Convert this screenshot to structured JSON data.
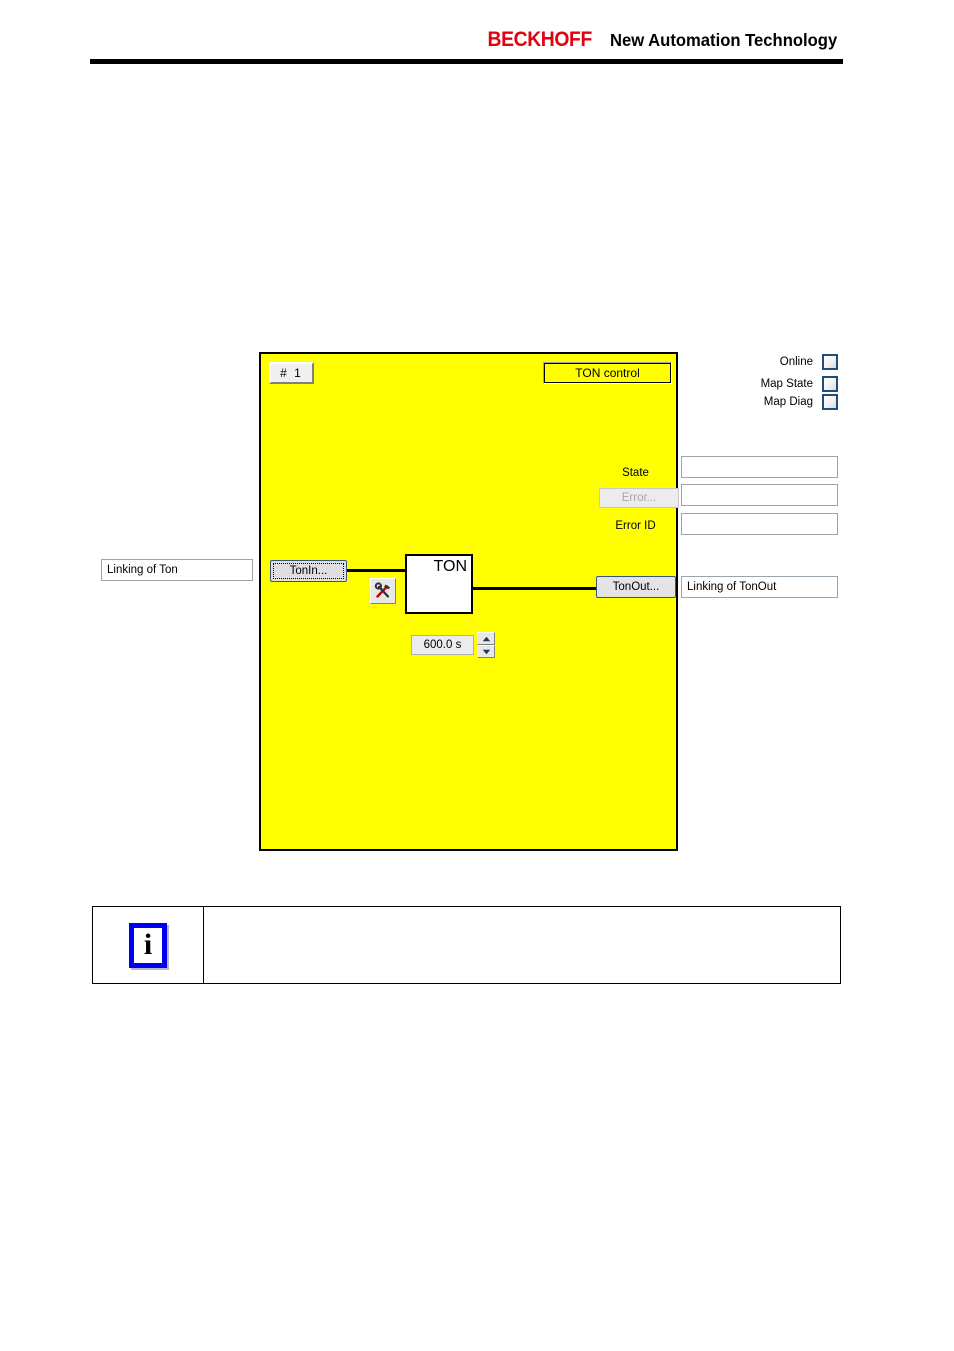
{
  "header": {
    "brand": "BECKHOFF",
    "tagline": "New Automation Technology"
  },
  "hmi_panel": {
    "index_label": "# 1",
    "title": "TON control",
    "state_label": "State",
    "error_button_label": "Error...",
    "error_id_label": "Error ID",
    "tonin_button_label": "TonIn...",
    "tools_icon": "hammer-wrench-icon",
    "block_label": "TON",
    "tonout_button_label": "TonOut...",
    "preset_value": "600.0 s",
    "spinner_up": "▲",
    "spinner_down": "▼",
    "background_color": "#ffff00"
  },
  "left_column": {
    "linking_ton_value": "Linking of Ton"
  },
  "right_column": {
    "checkboxes": [
      {
        "label": "Online",
        "checked": false
      },
      {
        "label": "Map State",
        "checked": false
      },
      {
        "label": "Map Diag",
        "checked": false
      }
    ],
    "state_value": "",
    "error_value": "",
    "error_id_value": "",
    "linking_tonout_value": "Linking of TonOut"
  },
  "note_box": {
    "icon": "info-icon",
    "icon_glyph": "i",
    "icon_color": "#0000ee",
    "text": ""
  }
}
